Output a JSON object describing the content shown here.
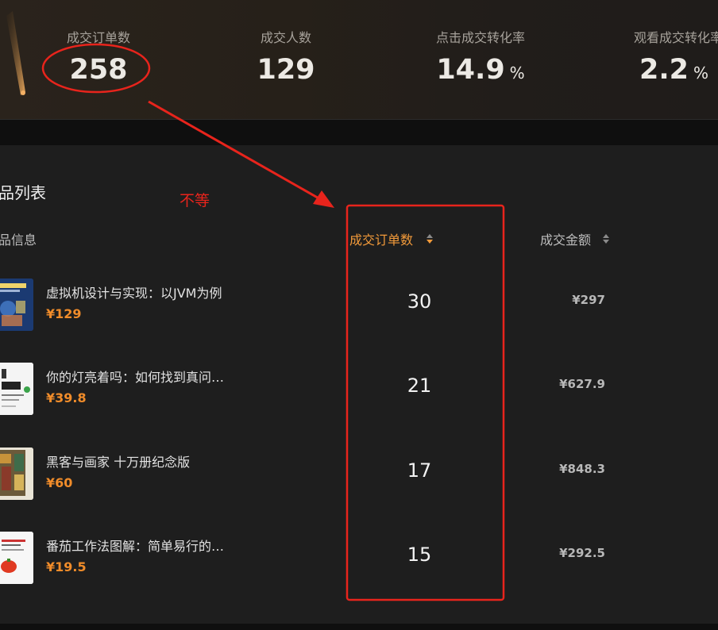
{
  "stats": [
    {
      "label": "成交订单数",
      "value": "258",
      "unit": ""
    },
    {
      "label": "成交人数",
      "value": "129",
      "unit": ""
    },
    {
      "label": "点击成交转化率",
      "value": "14.9",
      "unit": "%"
    },
    {
      "label": "观看成交转化率",
      "value": "2.2",
      "unit": "%"
    }
  ],
  "section_title": "品列表",
  "columns": {
    "product_info": "品信息",
    "orders": "成交订单数",
    "amount": "成交金额"
  },
  "products": [
    {
      "name": "虚拟机设计与实现：以JVM为例",
      "price": "¥129",
      "orders": "30",
      "amount": "¥297"
    },
    {
      "name": "你的灯亮着吗：如何找到真问…",
      "price": "¥39.8",
      "orders": "21",
      "amount": "¥627.9"
    },
    {
      "name": "黑客与画家 十万册纪念版",
      "price": "¥60",
      "orders": "17",
      "amount": "¥848.3"
    },
    {
      "name": "番茄工作法图解：简单易行的…",
      "price": "¥19.5",
      "orders": "15",
      "amount": "¥292.5"
    }
  ],
  "annotation": {
    "text": "不等",
    "color": "#e8241c"
  },
  "colors": {
    "accent": "#f29a3a",
    "price": "#f08c2a",
    "annotation": "#e8241c"
  },
  "icons": [
    "sort-icon",
    "book-cover-thumbnail"
  ]
}
